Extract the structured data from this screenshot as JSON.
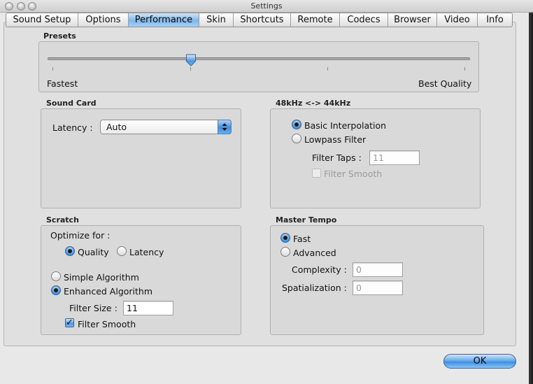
{
  "window": {
    "title": "Settings"
  },
  "tabs": [
    {
      "label": "Sound Setup"
    },
    {
      "label": "Options"
    },
    {
      "label": "Performance",
      "active": true
    },
    {
      "label": "Skin"
    },
    {
      "label": "Shortcuts"
    },
    {
      "label": "Remote"
    },
    {
      "label": "Codecs"
    },
    {
      "label": "Browser"
    },
    {
      "label": "Video"
    },
    {
      "label": "Info"
    }
  ],
  "presets": {
    "label": "Presets",
    "min_label": "Fastest",
    "max_label": "Best Quality",
    "value_fraction": 0.34
  },
  "sound_card": {
    "label": "Sound Card",
    "latency_label": "Latency :",
    "latency_value": "Auto"
  },
  "resample": {
    "label": "48kHz <-> 44kHz",
    "basic_label": "Basic Interpolation",
    "lowpass_label": "Lowpass Filter",
    "selected": "basic",
    "filter_taps_label": "Filter Taps :",
    "filter_taps_value": "11",
    "filter_smooth_label": "Filter Smooth",
    "filter_smooth_checked": false
  },
  "scratch": {
    "label": "Scratch",
    "optimize_label": "Optimize for :",
    "quality_label": "Quality",
    "latency_label": "Latency",
    "optimize_selected": "quality",
    "simple_label": "Simple Algorithm",
    "enhanced_label": "Enhanced Algorithm",
    "algorithm_selected": "enhanced",
    "filter_size_label": "Filter Size :",
    "filter_size_value": "11",
    "filter_smooth_label": "Filter Smooth",
    "filter_smooth_checked": true
  },
  "master_tempo": {
    "label": "Master Tempo",
    "fast_label": "Fast",
    "advanced_label": "Advanced",
    "selected": "fast",
    "complexity_label": "Complexity :",
    "complexity_value": "0",
    "spatialization_label": "Spatialization :",
    "spatialization_value": "0"
  },
  "ok_label": "OK",
  "colors": {
    "accent": "#3d8ee0",
    "panel": "#e0e0e0",
    "group": "#d9d9d9"
  }
}
